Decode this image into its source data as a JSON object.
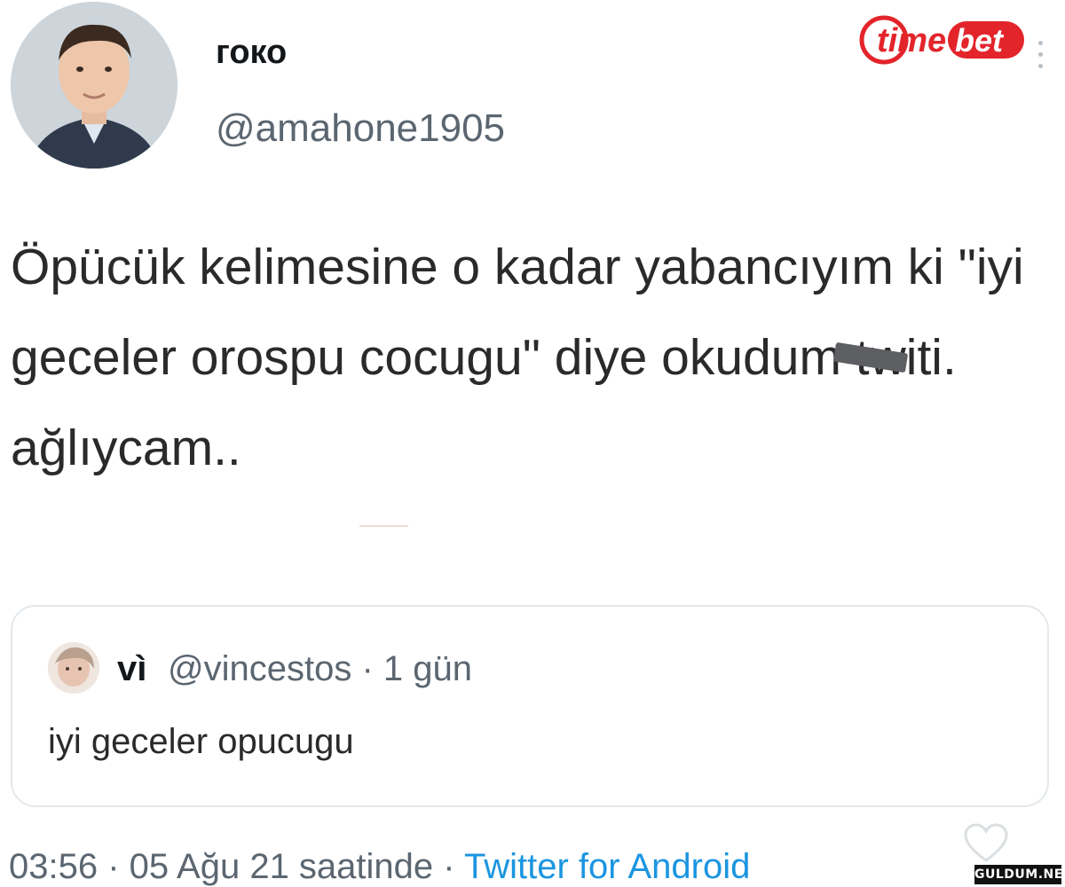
{
  "tweet": {
    "author_name": "гоко",
    "author_handle": "@amahone1905",
    "text": "Öpücük kelimesine o kadar yabancıyım ki  \"iyi geceler orospu cocugu\" diye okudum twiti. ağlıycam..",
    "quoted": {
      "author_name": "vì",
      "meta": "@vincestos · 1 gün",
      "text": "iyi geceler opucugu"
    },
    "footer_time": "03:56 · 05 Ağu 21 saatinde · ",
    "footer_source": "Twitter for Android"
  },
  "brand": {
    "logo_text": "timebet",
    "logo_text_a": "time",
    "logo_text_b": "bet",
    "accent": "#e3242b"
  },
  "watermark": {
    "text": "GULDUM.NET"
  },
  "icons": {
    "menu": "more-vertical-icon",
    "heart": "heart-icon"
  }
}
